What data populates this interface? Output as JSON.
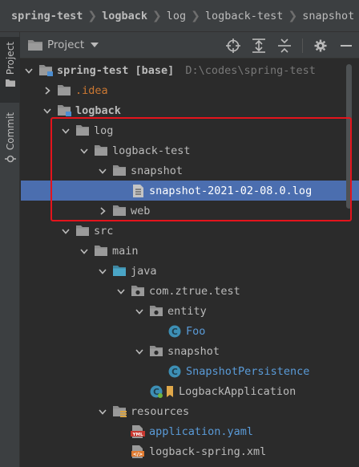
{
  "breadcrumb": [
    "spring-test",
    "logback",
    "log",
    "logback-test",
    "snapshot"
  ],
  "left_strip": {
    "project_label": "Project",
    "commit_label": "Commit"
  },
  "tool_window": {
    "title": "Project"
  },
  "tree": [
    {
      "label": "spring-test [base]",
      "hint": "D:\\codes\\spring-test",
      "depth": 0,
      "arrow": "down",
      "icon": "module-folder-icon",
      "style": "bold"
    },
    {
      "label": ".idea",
      "depth": 1,
      "arrow": "right",
      "icon": "folder-icon",
      "style": "excluded"
    },
    {
      "label": "logback",
      "depth": 1,
      "arrow": "down",
      "icon": "module-folder-icon",
      "style": "bold"
    },
    {
      "label": "log",
      "depth": 2,
      "arrow": "down",
      "icon": "folder-icon",
      "style": "normal"
    },
    {
      "label": "logback-test",
      "depth": 3,
      "arrow": "down",
      "icon": "folder-icon",
      "style": "normal"
    },
    {
      "label": "snapshot",
      "depth": 4,
      "arrow": "down",
      "icon": "folder-icon",
      "style": "normal"
    },
    {
      "label": "snapshot-2021-02-08.0.log",
      "depth": 5,
      "arrow": "none",
      "icon": "text-file-icon",
      "style": "normal",
      "selected": true
    },
    {
      "label": "web",
      "depth": 4,
      "arrow": "right",
      "icon": "folder-icon",
      "style": "normal"
    },
    {
      "label": "src",
      "depth": 2,
      "arrow": "down",
      "icon": "folder-icon",
      "style": "normal"
    },
    {
      "label": "main",
      "depth": 3,
      "arrow": "down",
      "icon": "folder-icon",
      "style": "normal"
    },
    {
      "label": "java",
      "depth": 4,
      "arrow": "down",
      "icon": "source-folder-icon",
      "style": "normal"
    },
    {
      "label": "com.ztrue.test",
      "depth": 5,
      "arrow": "down",
      "icon": "package-icon",
      "style": "normal"
    },
    {
      "label": "entity",
      "depth": 6,
      "arrow": "down",
      "icon": "package-icon",
      "style": "normal"
    },
    {
      "label": "Foo",
      "depth": 7,
      "arrow": "none",
      "icon": "class-icon",
      "style": "java"
    },
    {
      "label": "snapshot",
      "depth": 6,
      "arrow": "down",
      "icon": "package-icon",
      "style": "normal"
    },
    {
      "label": "SnapshotPersistence",
      "depth": 7,
      "arrow": "none",
      "icon": "class-icon",
      "style": "java"
    },
    {
      "label": "LogbackApplication",
      "depth": 6,
      "arrow": "none",
      "icon": "spring-class-icon",
      "style": "normal"
    },
    {
      "label": "resources",
      "depth": 4,
      "arrow": "down",
      "icon": "resources-folder-icon",
      "style": "normal"
    },
    {
      "label": "application.yaml",
      "depth": 5,
      "arrow": "none",
      "icon": "yaml-file-icon",
      "style": "yaml"
    },
    {
      "label": "logback-spring.xml",
      "depth": 5,
      "arrow": "none",
      "icon": "xml-file-icon",
      "style": "normal"
    }
  ],
  "colors": {
    "background": "#2b2b2b",
    "panel": "#3c3f41",
    "selection": "#4b6eaf",
    "highlight_box": "#e4141c",
    "excluded": "#cc7832",
    "java_class": "#5a9bd8",
    "folder": "#8c8c8c"
  }
}
